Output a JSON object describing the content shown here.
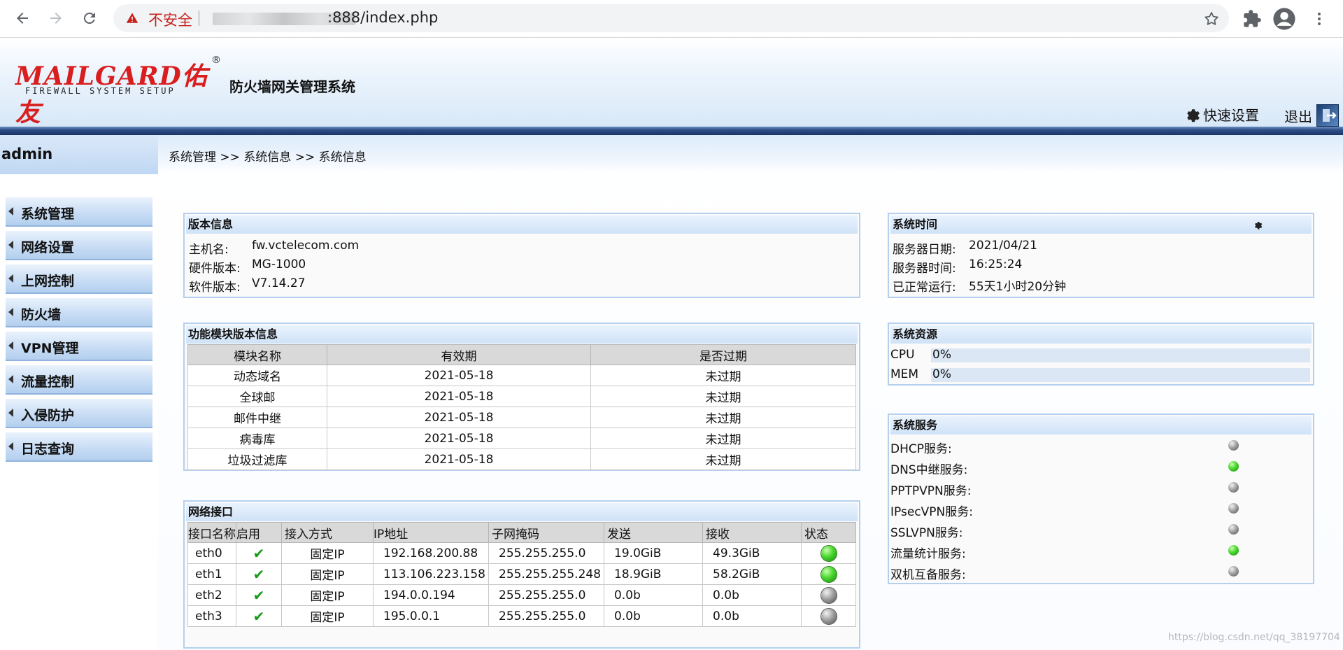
{
  "browser": {
    "security_label": "不安全",
    "url_visible": ":888/index.php"
  },
  "header": {
    "logo_text": "MAILGARD佑友",
    "logo_subtext": "FIREWALL SYSTEM SETUP",
    "logo_reg": "®",
    "system_title": "防火墙网关管理系统",
    "quick_setup_label": "快速设置",
    "logout_label": "退出"
  },
  "sidebar": {
    "user": "admin",
    "items": [
      {
        "label": "系统管理"
      },
      {
        "label": "网络设置"
      },
      {
        "label": "上网控制"
      },
      {
        "label": "防火墙"
      },
      {
        "label": "VPN管理"
      },
      {
        "label": "流量控制"
      },
      {
        "label": "入侵防护"
      },
      {
        "label": "日志查询"
      }
    ]
  },
  "breadcrumb": "系统管理 >> 系统信息 >> 系统信息",
  "version_info": {
    "title": "版本信息",
    "rows": [
      {
        "label": "主机名:",
        "value": "fw.vctelecom.com"
      },
      {
        "label": "硬件版本:",
        "value": "MG-1000"
      },
      {
        "label": "软件版本:",
        "value": "V7.14.27"
      }
    ]
  },
  "modules": {
    "title": "功能模块版本信息",
    "headers": [
      "模块名称",
      "有效期",
      "是否过期"
    ],
    "rows": [
      [
        "动态域名",
        "2021-05-18",
        "未过期"
      ],
      [
        "全球邮",
        "2021-05-18",
        "未过期"
      ],
      [
        "邮件中继",
        "2021-05-18",
        "未过期"
      ],
      [
        "病毒库",
        "2021-05-18",
        "未过期"
      ],
      [
        "垃圾过滤库",
        "2021-05-18",
        "未过期"
      ]
    ]
  },
  "interfaces": {
    "title": "网络接口",
    "headers": [
      "接口名称",
      "启用",
      "接入方式",
      "IP地址",
      "子网掩码",
      "发送",
      "接收",
      "状态"
    ],
    "rows": [
      {
        "name": "eth0",
        "enabled": "✔",
        "mode": "固定IP",
        "ip": "192.168.200.88",
        "mask": "255.255.255.0",
        "tx": "19.0GiB",
        "rx": "49.3GiB",
        "status": "green"
      },
      {
        "name": "eth1",
        "enabled": "✔",
        "mode": "固定IP",
        "ip": "113.106.223.158",
        "mask": "255.255.255.248",
        "tx": "18.9GiB",
        "rx": "58.2GiB",
        "status": "green"
      },
      {
        "name": "eth2",
        "enabled": "✔",
        "mode": "固定IP",
        "ip": "194.0.0.194",
        "mask": "255.255.255.0",
        "tx": "0.0b",
        "rx": "0.0b",
        "status": "gray"
      },
      {
        "name": "eth3",
        "enabled": "✔",
        "mode": "固定IP",
        "ip": "195.0.0.1",
        "mask": "255.255.255.0",
        "tx": "0.0b",
        "rx": "0.0b",
        "status": "gray"
      }
    ]
  },
  "system_time": {
    "title": "系统时间",
    "rows": [
      {
        "label": "服务器日期:",
        "value": "2021/04/21"
      },
      {
        "label": "服务器时间:",
        "value": "16:25:24"
      },
      {
        "label": "已正常运行:",
        "value": "55天1小时20分钟"
      }
    ]
  },
  "resources": {
    "title": "系统资源",
    "rows": [
      {
        "label": "CPU",
        "value": "0%"
      },
      {
        "label": "MEM",
        "value": "0%"
      }
    ]
  },
  "services": {
    "title": "系统服务",
    "rows": [
      {
        "label": "DHCP服务:",
        "status": "gray"
      },
      {
        "label": "DNS中继服务:",
        "status": "green"
      },
      {
        "label": "PPTPVPN服务:",
        "status": "gray"
      },
      {
        "label": "IPsecVPN服务:",
        "status": "gray"
      },
      {
        "label": "SSLVPN服务:",
        "status": "gray"
      },
      {
        "label": "流量统计服务:",
        "status": "green"
      },
      {
        "label": "双机互备服务:",
        "status": "gray"
      }
    ]
  },
  "watermark": "https://blog.csdn.net/qq_38197704",
  "colors": {
    "accent_red": "#d81e1e",
    "status_green": "#4ad62d",
    "status_gray": "#9a9a9a",
    "panel_border": "#b5d0ee"
  }
}
